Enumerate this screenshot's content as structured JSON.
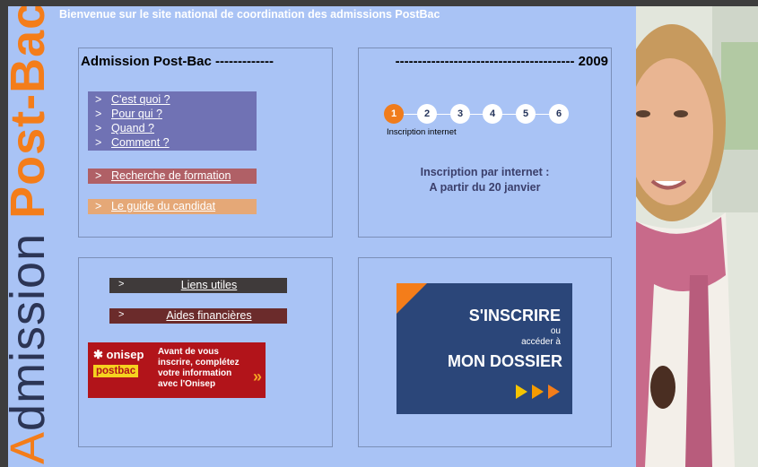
{
  "brand": {
    "vertical_title_1": "A",
    "vertical_title_2": "dmission",
    "vertical_title_3": "Post-Bac"
  },
  "header": {
    "welcome": "Bienvenue sur le site national de coordination des admissions PostBac"
  },
  "panel_admission": {
    "title": "Admission Post-Bac -------------",
    "menu": [
      {
        "arrow": ">",
        "label": "C'est quoi ?"
      },
      {
        "arrow": ">",
        "label": "Pour qui ?"
      },
      {
        "arrow": ">",
        "label": "Quand ?"
      },
      {
        "arrow": ">",
        "label": "Comment ?"
      }
    ],
    "recherche": {
      "arrow": ">",
      "label": "Recherche de formation"
    },
    "guide": {
      "arrow": ">",
      "label": "Le guide du candidat"
    }
  },
  "panel_calendar": {
    "title": "---------------------------------------- 2009",
    "steps": [
      "1",
      "2",
      "3",
      "4",
      "5",
      "6"
    ],
    "active_step": 1,
    "step_caption": "Inscription internet",
    "info_line1": "Inscription par internet :",
    "info_line2": "A partir du 20 janvier"
  },
  "panel_links": {
    "liens": {
      "arrow": ">",
      "label": "Liens utiles"
    },
    "aides": {
      "arrow": ">",
      "label": "Aides financières"
    },
    "onisep": {
      "logo_line1": "onisep",
      "logo_line2": "postbac",
      "text": "Avant de vous inscrire, complétez votre information avec l'Onisep",
      "go_icon": "double-chevron-right-icon"
    }
  },
  "panel_cta": {
    "line1": "S'INSCRIRE",
    "line2": "ou",
    "line3": "accéder à",
    "line4": "MON DOSSIER",
    "arrow_color": "#f5a623"
  },
  "colors": {
    "accent_orange": "#f47d1a",
    "page_bg": "#a9c3f5",
    "cta_blue": "#2b4679"
  }
}
